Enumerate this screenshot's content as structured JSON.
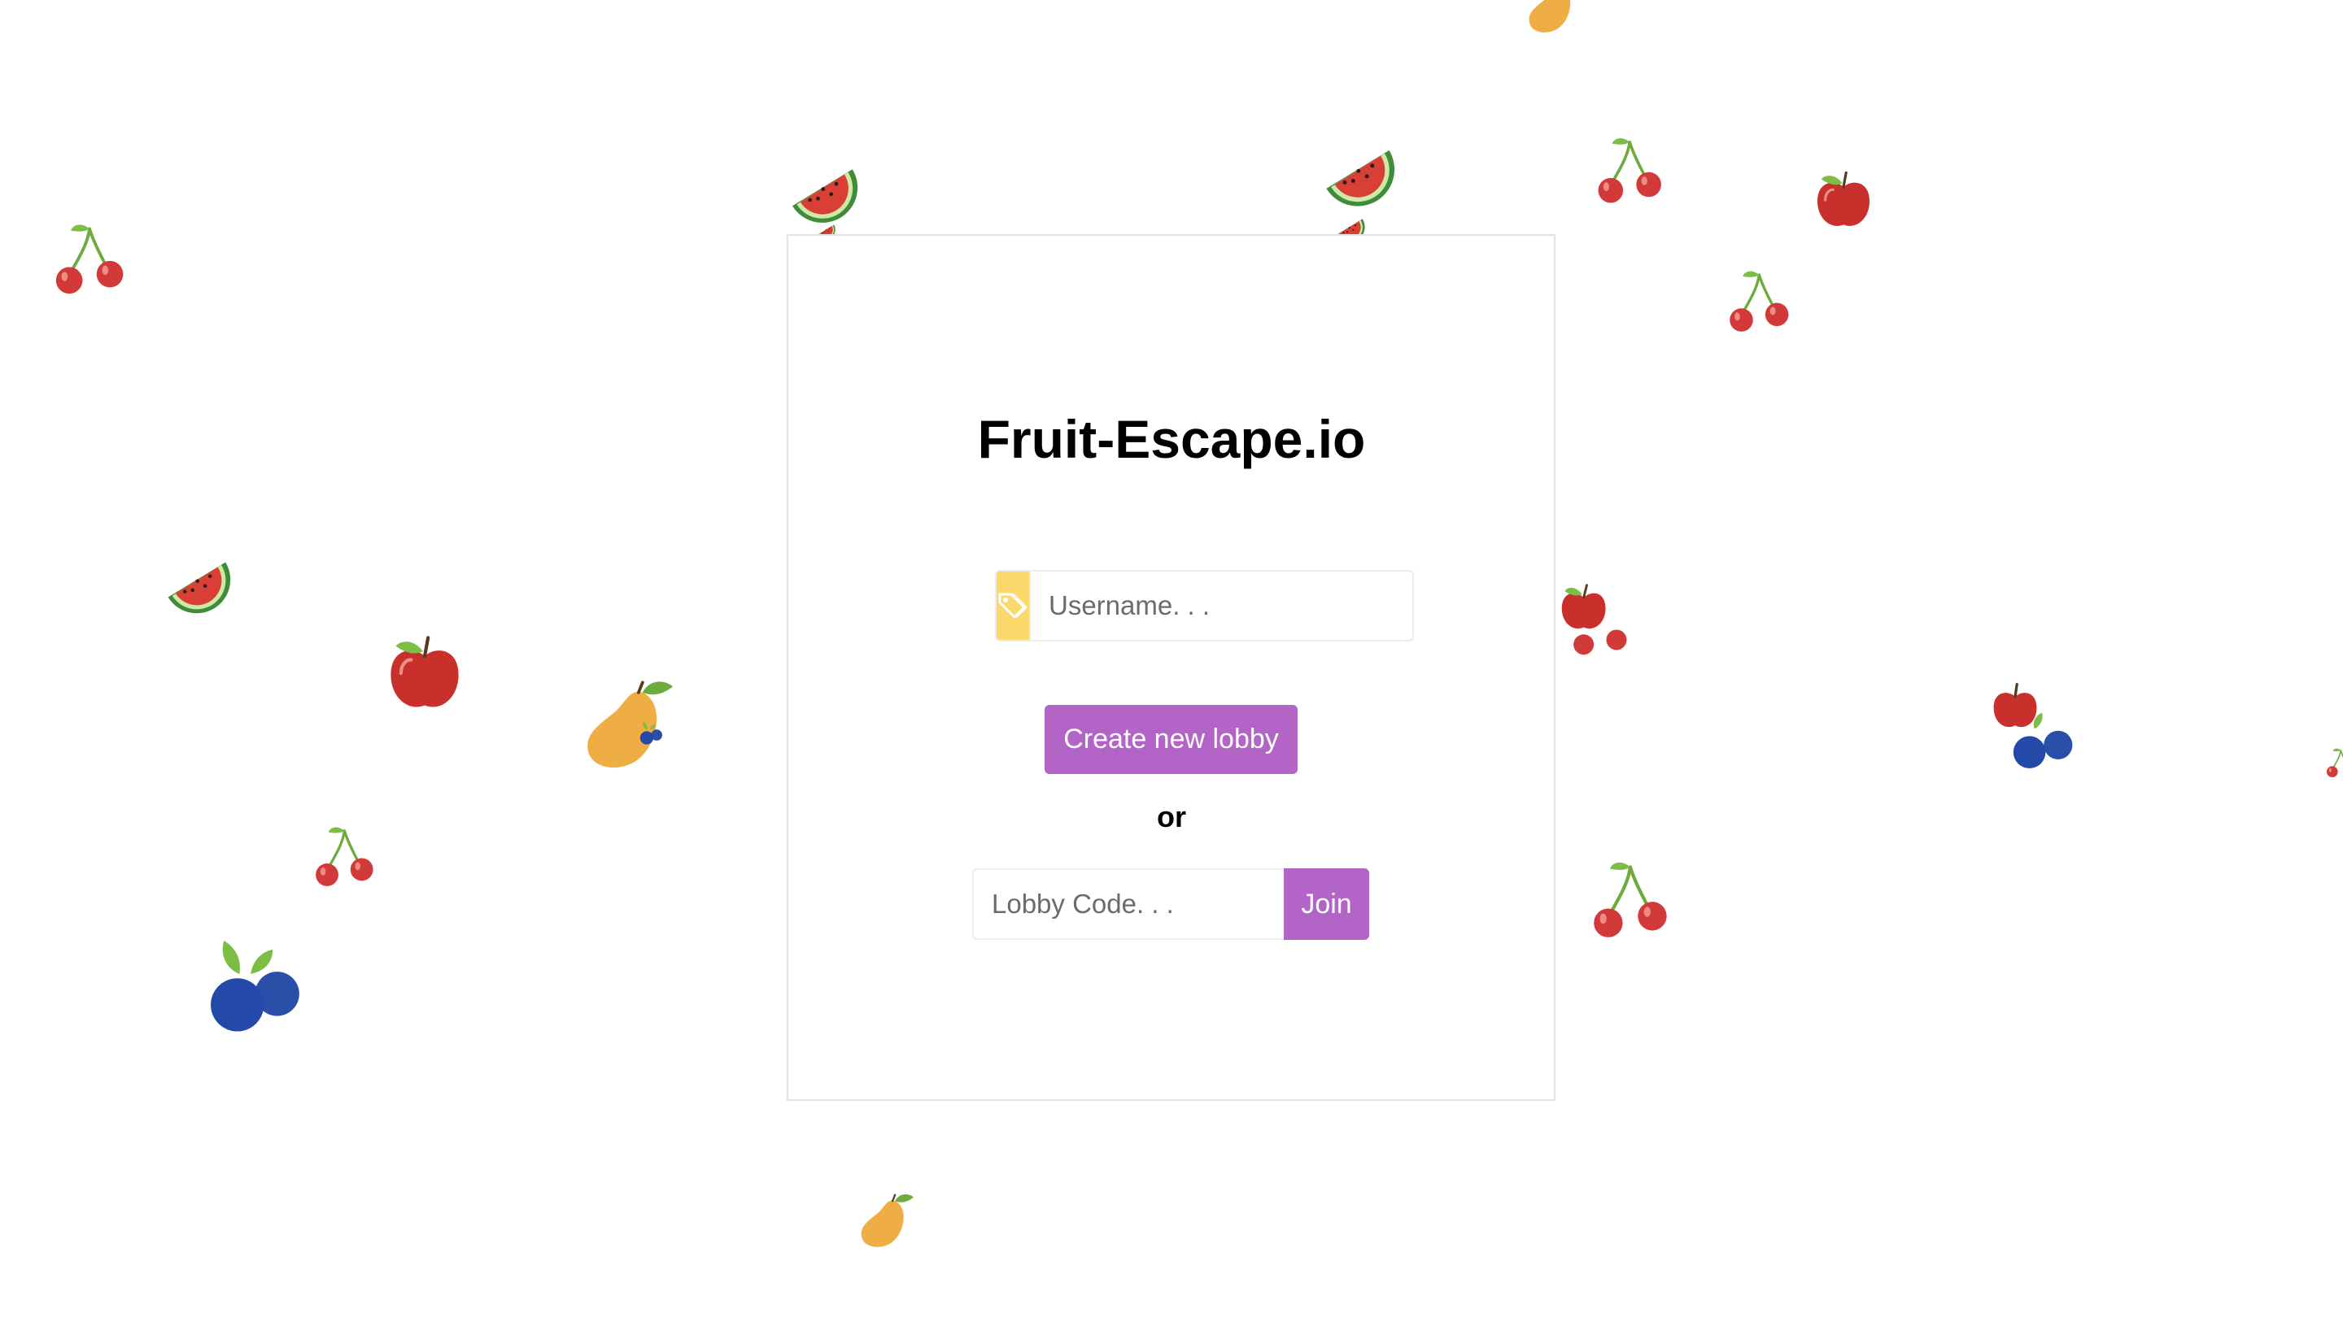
{
  "app": {
    "title": "Fruit-Escape.io"
  },
  "username": {
    "placeholder": "Username. . .",
    "value": "",
    "icon": "tag-icon"
  },
  "create_lobby": {
    "label": "Create new lobby"
  },
  "separator": {
    "text": "or"
  },
  "join_lobby": {
    "placeholder": "Lobby Code. . .",
    "value": "",
    "button_label": "Join"
  },
  "colors": {
    "primary_button": "#b364c7",
    "username_addon": "#fbd86a",
    "cherry": "#d23a3a",
    "apple": "#c9302c",
    "watermelon": "#d93f35",
    "mango": "#efae44",
    "blueberry": "#234aa8",
    "leaf": "#6cab3c"
  },
  "background_fruits": [
    "cherry-icon",
    "watermelon-icon",
    "apple-icon",
    "mango-icon",
    "blueberry-icon"
  ]
}
